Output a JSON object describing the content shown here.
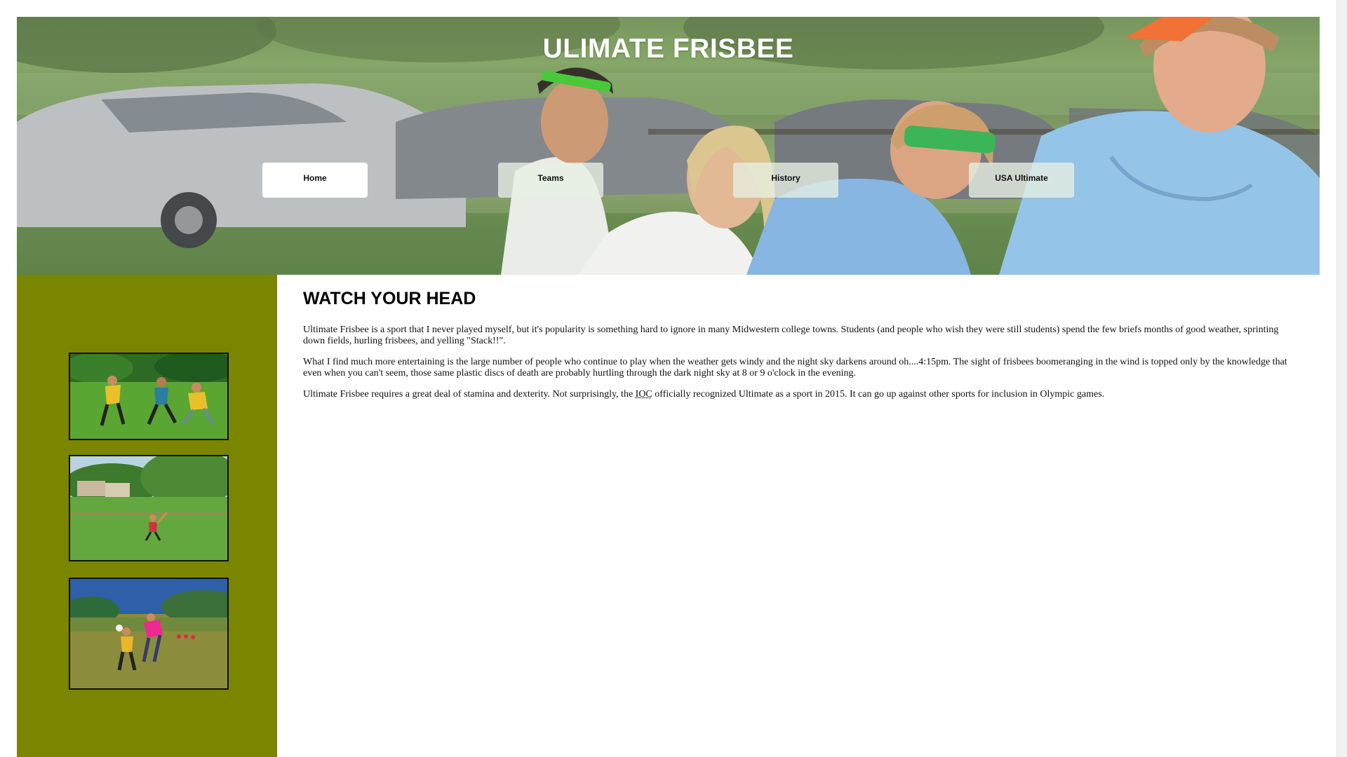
{
  "header": {
    "title": "ULIMATE FRISBEE"
  },
  "nav": {
    "items": [
      {
        "label": "Home",
        "active": true
      },
      {
        "label": "Teams",
        "active": false
      },
      {
        "label": "History",
        "active": false
      },
      {
        "label": "USA Ultimate",
        "active": false
      }
    ]
  },
  "sidebar": {
    "background": "#7a8500",
    "photos": [
      {
        "name": "frisbee-photo-1"
      },
      {
        "name": "frisbee-photo-2"
      },
      {
        "name": "frisbee-photo-3"
      }
    ]
  },
  "main": {
    "heading": "WATCH YOUR HEAD",
    "p1": "Ultimate Frisbee is a sport that I never played myself, but it's popularity is something hard to ignore in many Midwestern college towns. Students (and people who wish they were still students) spend the few briefs months of good weather, sprinting down fields, hurling frisbees, and yelling \"Stack!!\".",
    "p2": "What I find much more entertaining is the large number of people who continue to play when the weather gets windy and the night sky darkens around oh....4:15pm. The sight of frisbees boomeranging in the wind is topped only by the knowledge that even when you can't seem, those same plastic discs of death are probably hurtling through the dark night sky at 8 or 9 o'clock in the evening.",
    "p3_before": "Ultimate Frisbee requires a great deal of stamina and dexterity. Not surprisingly, the ",
    "p3_abbr": "IOC",
    "p3_after": " officially recognized Ultimate as a sport in 2015. It can go up against other sports for inclusion in Olympic games."
  }
}
